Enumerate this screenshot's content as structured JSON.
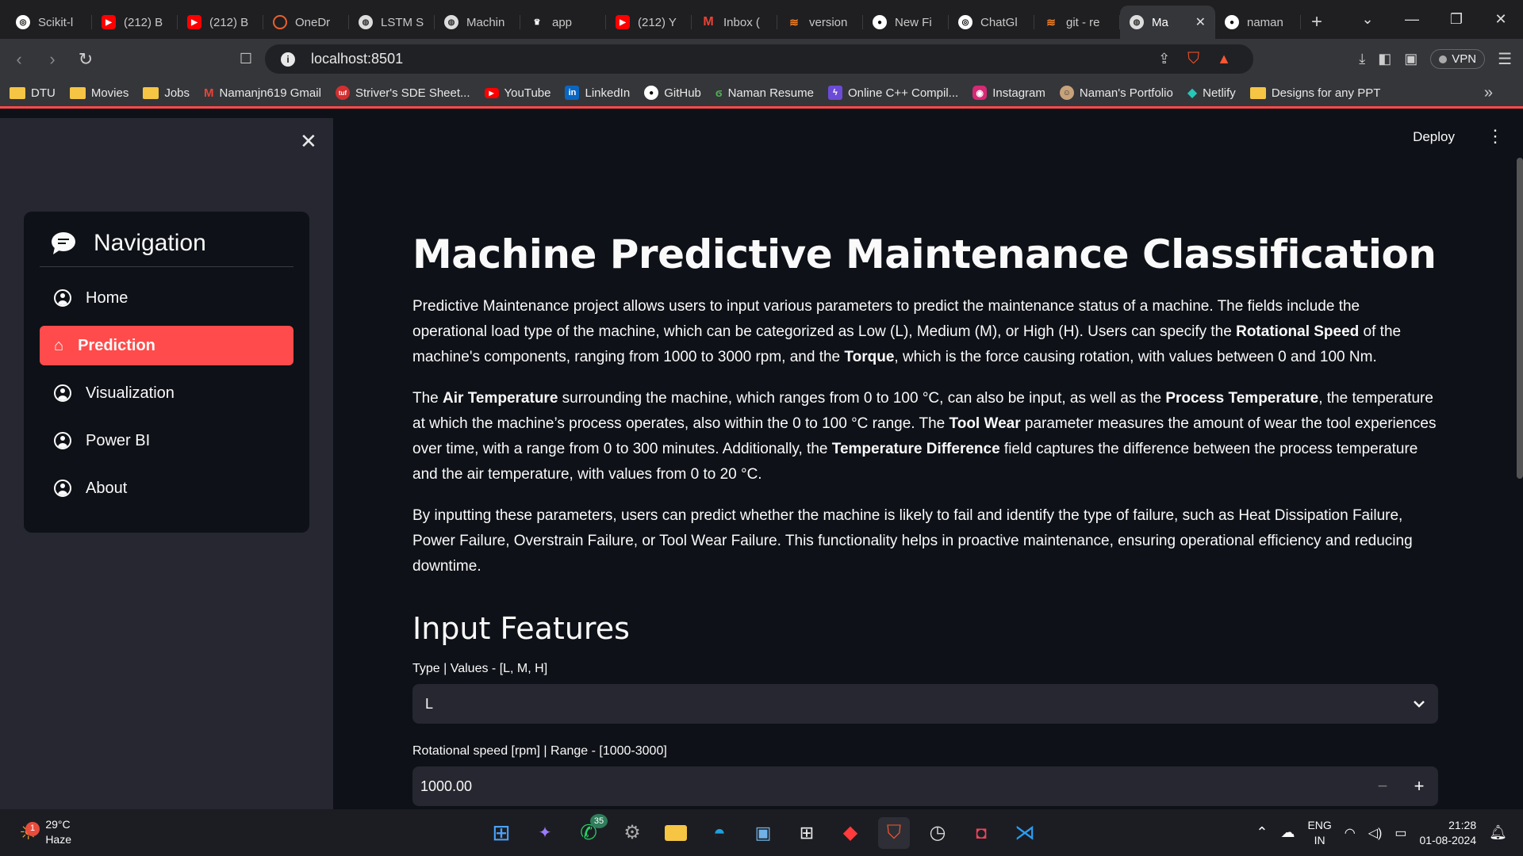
{
  "browser": {
    "tabs": [
      {
        "label": "Scikit-l",
        "icon": "openai-icon"
      },
      {
        "label": "(212) B",
        "icon": "youtube-icon"
      },
      {
        "label": "(212) B",
        "icon": "youtube-icon"
      },
      {
        "label": "OneDr",
        "icon": "onedrive-icon"
      },
      {
        "label": "LSTM S",
        "icon": "globe-icon"
      },
      {
        "label": "Machin",
        "icon": "globe-icon"
      },
      {
        "label": "app",
        "icon": "streamlit-icon"
      },
      {
        "label": "(212) Y",
        "icon": "youtube-icon"
      },
      {
        "label": "Inbox (",
        "icon": "gmail-icon"
      },
      {
        "label": "version",
        "icon": "stackoverflow-icon"
      },
      {
        "label": "New Fi",
        "icon": "github-icon"
      },
      {
        "label": "ChatGl",
        "icon": "openai-icon"
      },
      {
        "label": "git - re",
        "icon": "stackoverflow-icon"
      },
      {
        "label": "Ma",
        "icon": "globe-icon",
        "active": true
      },
      {
        "label": "naman",
        "icon": "github-icon"
      }
    ],
    "url": "localhost:8501",
    "vpn_label": "VPN",
    "bookmarks": [
      {
        "label": "DTU",
        "icon": "folder-icon"
      },
      {
        "label": "Movies",
        "icon": "folder-icon"
      },
      {
        "label": "Jobs",
        "icon": "folder-icon"
      },
      {
        "label": "Namanjn619 Gmail",
        "icon": "gmail-icon"
      },
      {
        "label": "Striver's SDE Sheet...",
        "icon": "tuf-icon"
      },
      {
        "label": "YouTube",
        "icon": "youtube-icon"
      },
      {
        "label": "LinkedIn",
        "icon": "linkedin-icon"
      },
      {
        "label": "GitHub",
        "icon": "github-icon"
      },
      {
        "label": "Naman Resume",
        "icon": "resume-icon"
      },
      {
        "label": "Online C++ Compil...",
        "icon": "compiler-icon"
      },
      {
        "label": "Instagram",
        "icon": "instagram-icon"
      },
      {
        "label": "Naman's Portfolio",
        "icon": "portfolio-icon"
      },
      {
        "label": "Netlify",
        "icon": "netlify-icon"
      },
      {
        "label": "Designs for any PPT",
        "icon": "folder-icon"
      }
    ]
  },
  "sidebar": {
    "nav_title": "Navigation",
    "items": [
      {
        "label": "Home",
        "active": false
      },
      {
        "label": "Prediction",
        "active": true
      },
      {
        "label": "Visualization",
        "active": false
      },
      {
        "label": "Power BI",
        "active": false
      },
      {
        "label": "About",
        "active": false
      }
    ]
  },
  "header": {
    "deploy_label": "Deploy"
  },
  "main": {
    "title": "Machine Predictive Maintenance Classification",
    "section_title": "Input Features",
    "type_label": "Type | Values - [L, M, H]",
    "type_value": "L",
    "rpm_label": "Rotational speed [rpm] | Range - [1000-3000]",
    "rpm_value": "1000.00"
  },
  "taskbar": {
    "weather_temp": "29°C",
    "weather_desc": "Haze",
    "weather_badge": "1",
    "whatsapp_badge": "35",
    "lang_top": "ENG",
    "lang_bottom": "IN",
    "time": "21:28",
    "date": "01-08-2024"
  },
  "colors": {
    "accent": "#ff4b4b",
    "background": "#0e1117",
    "sidebar": "#262730"
  }
}
